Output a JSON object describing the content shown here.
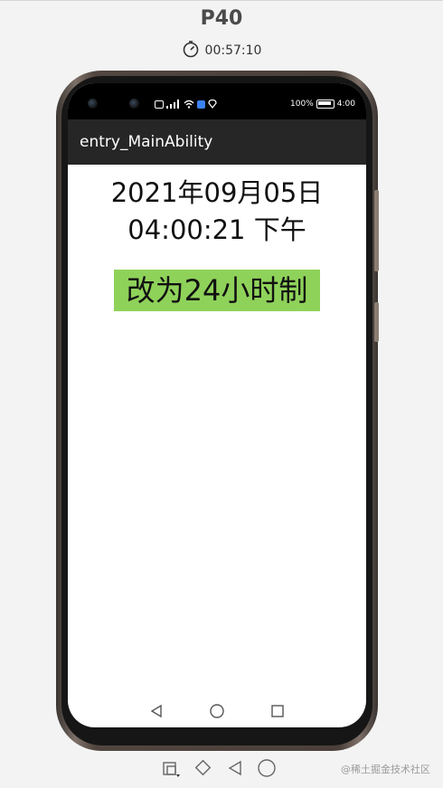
{
  "emulator": {
    "device_name": "P40",
    "elapsed_time": "00:57:10"
  },
  "status_bar": {
    "battery_percent": "100%",
    "clock": "4:00"
  },
  "app": {
    "title": "entry_MainAbility",
    "date_text": "2021年09月05日",
    "time_text": "04:00:21 下午",
    "toggle_button_label": "改为24小时制",
    "toggle_button_color": "#8fd25a"
  },
  "watermark": "@稀土掘金技术社区"
}
